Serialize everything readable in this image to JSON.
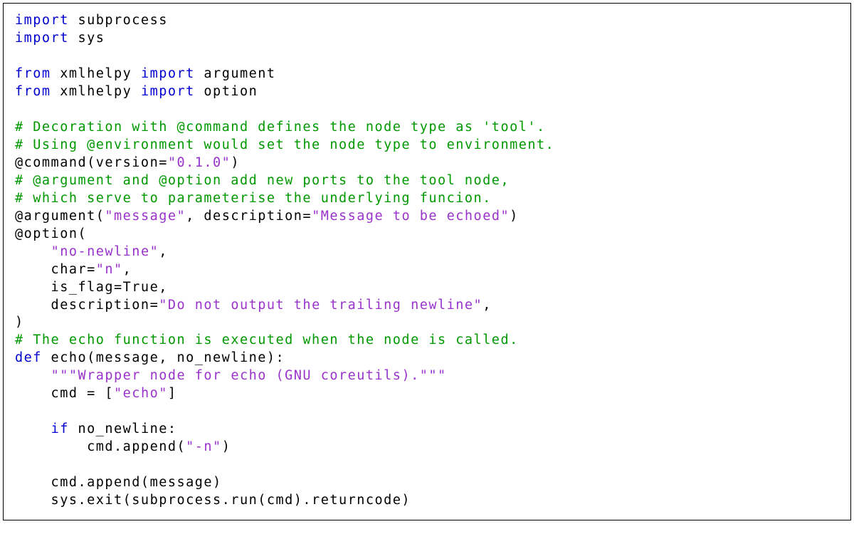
{
  "code": {
    "l01a": "import",
    "l01b": " subprocess",
    "l02a": "import",
    "l02b": " sys",
    "l03": "",
    "l04a": "from",
    "l04b": " xmlhelpy ",
    "l04c": "import",
    "l04d": " argument",
    "l05a": "from",
    "l05b": " xmlhelpy ",
    "l05c": "import",
    "l05d": " option",
    "l06": "",
    "l07": "# Decoration with @command defines the node type as 'tool'.",
    "l08": "# Using @environment would set the node type to environment.",
    "l09a": "@command(version=",
    "l09b": "\"0.1.0\"",
    "l09c": ")",
    "l10": "# @argument and @option add new ports to the tool node,",
    "l11": "# which serve to parameterise the underlying funcion.",
    "l12a": "@argument(",
    "l12b": "\"message\"",
    "l12c": ", description=",
    "l12d": "\"Message to be echoed\"",
    "l12e": ")",
    "l13": "@option(",
    "l14a": "    ",
    "l14b": "\"no-newline\"",
    "l14c": ",",
    "l15a": "    char=",
    "l15b": "\"n\"",
    "l15c": ",",
    "l16": "    is_flag=True,",
    "l17a": "    description=",
    "l17b": "\"Do not output the trailing newline\"",
    "l17c": ",",
    "l18": ")",
    "l19": "# The echo function is executed when the node is called.",
    "l20a": "def",
    "l20b": " echo(message, no_newline):",
    "l21a": "    ",
    "l21b": "\"\"\"Wrapper node for echo (GNU coreutils).\"\"\"",
    "l22a": "    cmd = [",
    "l22b": "\"echo\"",
    "l22c": "]",
    "l23": "",
    "l24a": "    ",
    "l24b": "if",
    "l24c": " no_newline:",
    "l25a": "        cmd.append(",
    "l25b": "\"-n\"",
    "l25c": ")",
    "l26": "",
    "l27": "    cmd.append(message)",
    "l28": "    sys.exit(subprocess.run(cmd).returncode)"
  }
}
